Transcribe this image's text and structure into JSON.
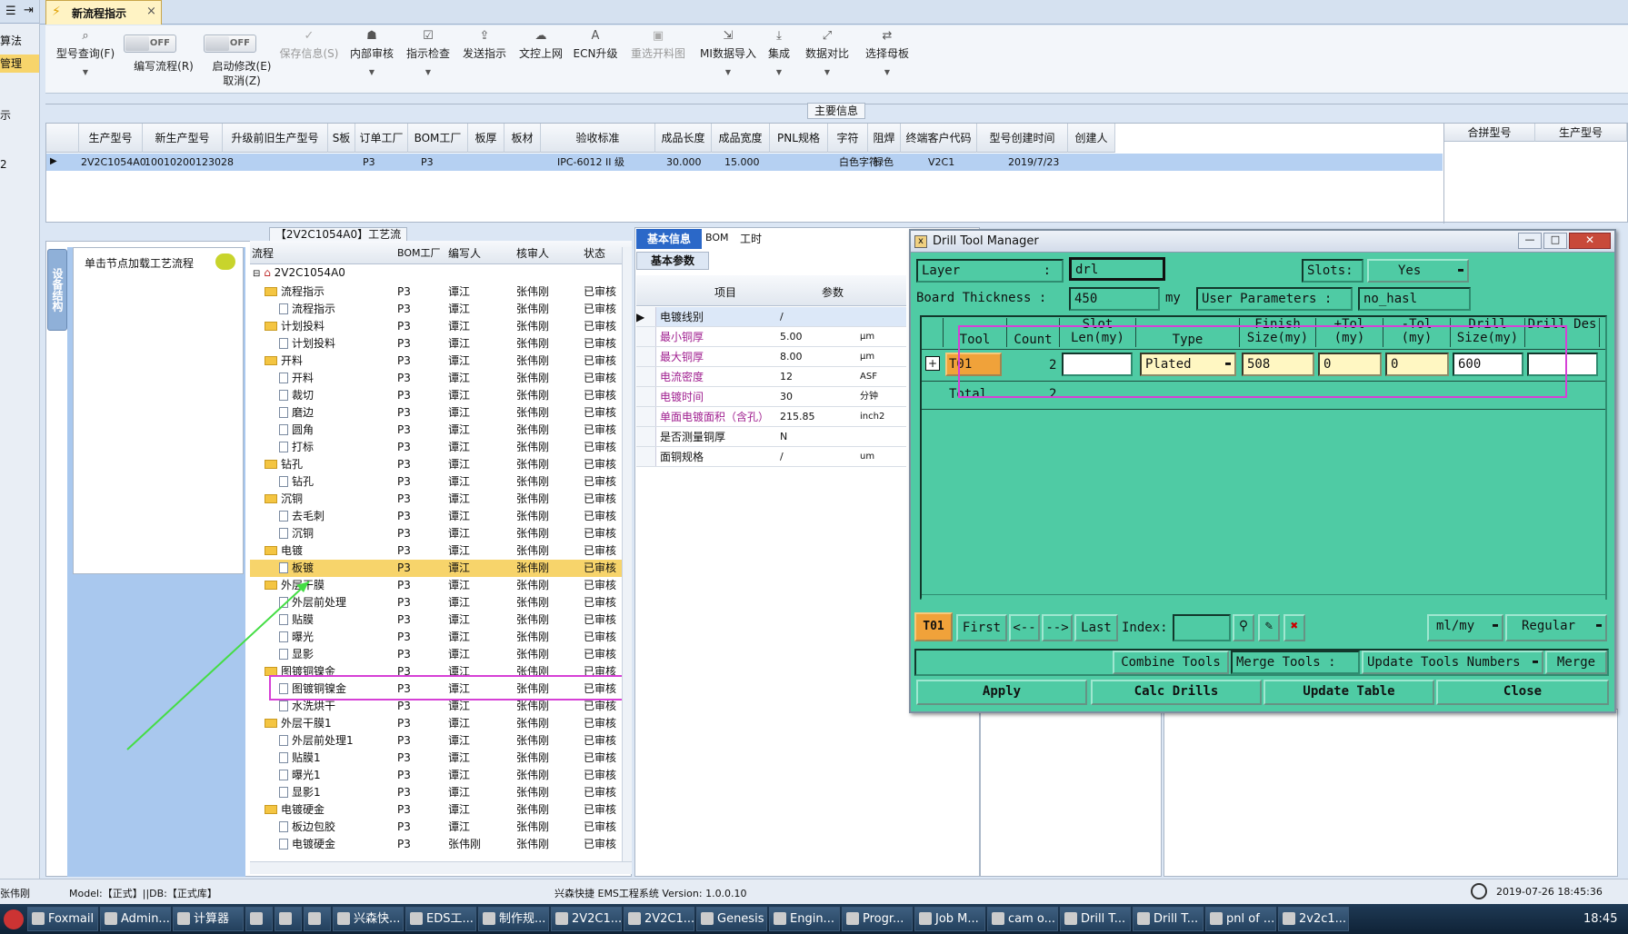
{
  "left_strip": {
    "items": [
      "算法",
      "管理",
      "示",
      "2"
    ]
  },
  "tab": {
    "title": "新流程指示",
    "close": "×"
  },
  "toolbar": {
    "items": [
      {
        "label": "型号查询(F)",
        "icon": "search-icon"
      },
      {
        "label": "编写流程(R)",
        "toggle": "OFF"
      },
      {
        "label": "启动修改(E)",
        "sub": "取消(Z)",
        "toggle": "OFF"
      },
      {
        "label": "保存信息(S)",
        "icon": "check-icon"
      },
      {
        "label": "内部审核",
        "icon": "person-icon"
      },
      {
        "label": "指示检查",
        "icon": "checklist-icon"
      },
      {
        "label": "发送指示",
        "icon": "upload-icon"
      },
      {
        "label": "文控上网",
        "icon": "cloud-upload-icon"
      },
      {
        "label": "ECN升级",
        "icon": "font-icon"
      },
      {
        "label": "重选开料图",
        "icon": "image-icon"
      },
      {
        "label": "MI数据导入",
        "icon": "import-icon"
      },
      {
        "label": "集成",
        "icon": "download-icon"
      },
      {
        "label": "数据对比",
        "icon": "compare-icon"
      },
      {
        "label": "选择母板",
        "icon": "shuffle-icon"
      }
    ]
  },
  "main_info": {
    "title": "主要信息",
    "columns": [
      "生产型号",
      "新生产型号",
      "升级前旧生产型号",
      "S板",
      "订单工厂",
      "BOM工厂",
      "板厚",
      "板材",
      "验收标准",
      "成品长度",
      "成品宽度",
      "PNL规格",
      "字符",
      "阻焊",
      "终端客户代码",
      "型号创建时间",
      "创建人"
    ],
    "row": [
      "2V2C1054A0",
      "10010200123028",
      "",
      "",
      "P3",
      "P3",
      "",
      "",
      "IPC-6012 II 级",
      "30.000",
      "15.000",
      "",
      "白色字符",
      "绿色",
      "V2C1",
      "2019/7/23",
      ""
    ],
    "side_columns": [
      "合拼型号",
      "生产型号"
    ]
  },
  "process": {
    "title": "【2V2C1054A0】工艺流程",
    "side_tab": "设备结构",
    "load_hint": "单击节点加载工艺流程",
    "columns": [
      "流程",
      "BOM工厂",
      "编写人",
      "核审人",
      "状态"
    ],
    "root": "2V2C1054A0",
    "rows": [
      {
        "name": "流程指示",
        "level": 1,
        "folder": true
      },
      {
        "name": "流程指示",
        "level": 2
      },
      {
        "name": "计划投料",
        "level": 1,
        "folder": true
      },
      {
        "name": "计划投料",
        "level": 2
      },
      {
        "name": "开料",
        "level": 1,
        "folder": true
      },
      {
        "name": "开料",
        "level": 2
      },
      {
        "name": "裁切",
        "level": 2
      },
      {
        "name": "磨边",
        "level": 2
      },
      {
        "name": "圆角",
        "level": 2
      },
      {
        "name": "打标",
        "level": 2
      },
      {
        "name": "钻孔",
        "level": 1,
        "folder": true
      },
      {
        "name": "钻孔",
        "level": 2
      },
      {
        "name": "沉铜",
        "level": 1,
        "folder": true
      },
      {
        "name": "去毛刺",
        "level": 2
      },
      {
        "name": "沉铜",
        "level": 2
      },
      {
        "name": "电镀",
        "level": 1,
        "folder": true
      },
      {
        "name": "板镀",
        "level": 2,
        "selected": true
      },
      {
        "name": "外层干膜",
        "level": 1,
        "folder": true
      },
      {
        "name": "外层前处理",
        "level": 2
      },
      {
        "name": "贴膜",
        "level": 2
      },
      {
        "name": "曝光",
        "level": 2
      },
      {
        "name": "显影",
        "level": 2
      },
      {
        "name": "图镀铜镍金",
        "level": 1,
        "folder": true
      },
      {
        "name": "图镀铜镍金",
        "level": 2,
        "highlight": true
      },
      {
        "name": "水洗烘干",
        "level": 2
      },
      {
        "name": "外层干膜1",
        "level": 1,
        "folder": true
      },
      {
        "name": "外层前处理1",
        "level": 2
      },
      {
        "name": "贴膜1",
        "level": 2
      },
      {
        "name": "曝光1",
        "level": 2
      },
      {
        "name": "显影1",
        "level": 2
      },
      {
        "name": "电镀硬金",
        "level": 1,
        "folder": true
      },
      {
        "name": "板边包胶",
        "level": 2
      },
      {
        "name": "电镀硬金",
        "level": 2,
        "writer": "张伟刚"
      }
    ],
    "bom": "P3",
    "writer": "谭江",
    "reviewer": "张伟刚",
    "status": "已审核"
  },
  "params": {
    "tabs": [
      "基本信息",
      "BOM",
      "工时"
    ],
    "subtab": "基本参数",
    "columns": [
      "项目",
      "参数"
    ],
    "rows": [
      {
        "item": "电镀线别",
        "value": "/",
        "unit": ""
      },
      {
        "item": "最小铜厚",
        "value": "5.00",
        "unit": "μm"
      },
      {
        "item": "最大铜厚",
        "value": "8.00",
        "unit": "μm"
      },
      {
        "item": "电流密度",
        "value": "12",
        "unit": "ASF"
      },
      {
        "item": "电镀时间",
        "value": "30",
        "unit": "分钟"
      },
      {
        "item": "单面电镀面积（含孔）",
        "value": "215.85",
        "unit": "inch2"
      },
      {
        "item": "是否测量铜厚",
        "value": "N",
        "unit": ""
      },
      {
        "item": "面铜规格",
        "value": "/",
        "unit": "um"
      }
    ]
  },
  "drill_manager": {
    "title": "Drill Tool Manager",
    "layer_label": "Layer",
    "layer_sep": ":",
    "layer_value": "drl",
    "slots_label": "Slots:",
    "slots_value": "Yes",
    "board_thickness_label": "Board Thickness :",
    "board_thickness_value": "450",
    "board_thickness_unit": "my",
    "user_params_label": "User Parameters :",
    "user_params_value": "no_hasl",
    "grid_columns": [
      "Tool",
      "Count",
      "Slot Len(my)",
      "Type",
      "Finish Size(my)",
      "+Tol (my)",
      "-Tol (my)",
      "Drill Size(my)",
      "Drill Des"
    ],
    "row": {
      "tool": "T01",
      "count": "2",
      "slot_len": "",
      "type": "Plated",
      "finish": "508",
      "ptol": "0",
      "ntol": "0",
      "drill": "600",
      "des": ""
    },
    "total_label": "Total",
    "total_count": "2",
    "nav": {
      "current": "T01",
      "first": "First",
      "prev": "<--",
      "next": "-->",
      "last": "Last",
      "index_label": "Index:",
      "units": "ml/my",
      "mode": "Regular"
    },
    "actions": {
      "combine": "Combine Tools",
      "merge_label": "Merge Tools :",
      "update_numbers": "Update Tools Numbers",
      "merge": "Merge"
    },
    "bottom": {
      "apply": "Apply",
      "calc": "Calc Drills",
      "update": "Update Table",
      "close": "Close"
    }
  },
  "status": {
    "user": "张伟刚",
    "model": "Model:【正式】||DB:【正式库】",
    "system": "兴森快捷 EMS工程系统 Version: 1.0.0.10",
    "time": "2019-07-26 18:45:36"
  },
  "taskbar": {
    "items": [
      "Foxmail",
      "Admin...",
      "计算器",
      "",
      "",
      "",
      "兴森快...",
      "EDS工...",
      "制作规...",
      "2V2C1...",
      "2V2C1...",
      "Genesis",
      "Engin...",
      "Progr...",
      "Job M...",
      "cam o...",
      "Drill T...",
      "Drill T...",
      "pnl of ...",
      "2v2c1..."
    ],
    "clock": "18:45"
  }
}
